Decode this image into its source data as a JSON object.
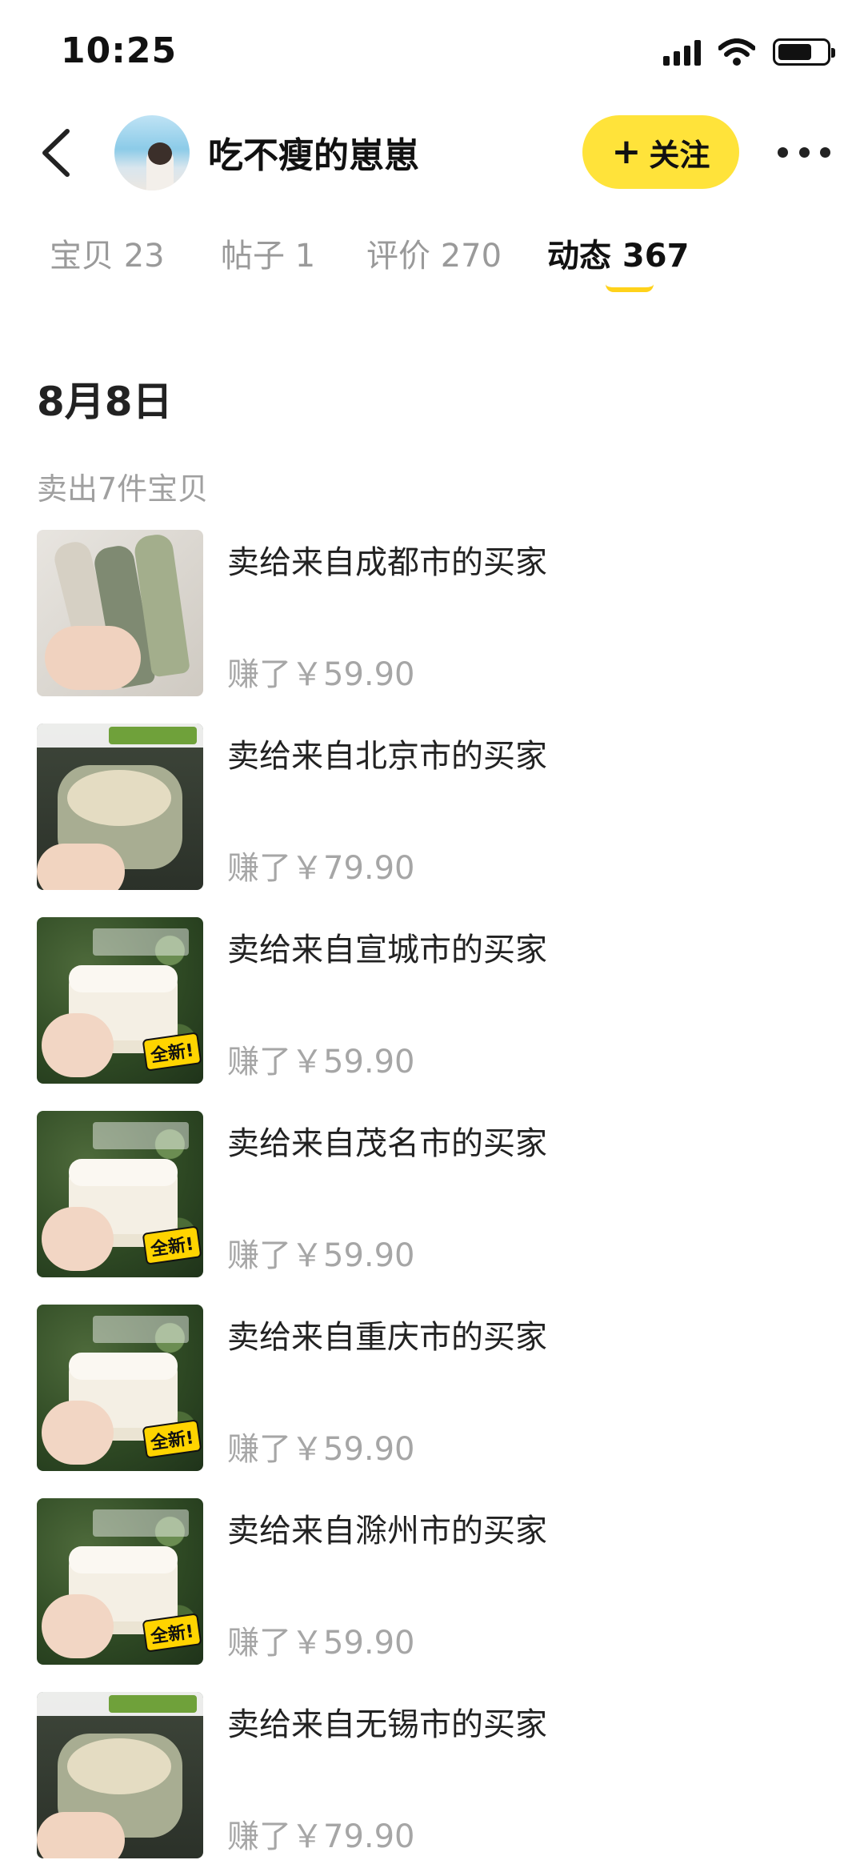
{
  "status_bar": {
    "time": "10:25"
  },
  "header": {
    "username": "吃不瘦的崽崽",
    "follow_label": "关注",
    "follow_plus": "+"
  },
  "tabs": [
    {
      "label": "宝贝 23",
      "active": false
    },
    {
      "label": "帖子 1",
      "active": false
    },
    {
      "label": "评价 270",
      "active": false
    },
    {
      "label": "动态 367",
      "active": true
    }
  ],
  "feed": {
    "date": "8月8日",
    "summary": "卖出7件宝贝",
    "items": [
      {
        "title": "卖给来自成都市的买家",
        "earned": "赚了￥59.90",
        "image": "bottles-photo",
        "badge": ""
      },
      {
        "title": "卖给来自北京市的买家",
        "earned": "赚了￥79.90",
        "image": "mask-jar-photo",
        "badge": ""
      },
      {
        "title": "卖给来自宣城市的买家",
        "earned": "赚了￥59.90",
        "image": "white-jar-photo",
        "badge": "全新!"
      },
      {
        "title": "卖给来自茂名市的买家",
        "earned": "赚了￥59.90",
        "image": "white-jar-photo",
        "badge": "全新!"
      },
      {
        "title": "卖给来自重庆市的买家",
        "earned": "赚了￥59.90",
        "image": "white-jar-photo",
        "badge": "全新!"
      },
      {
        "title": "卖给来自滁州市的买家",
        "earned": "赚了￥59.90",
        "image": "white-jar-photo",
        "badge": "全新!"
      },
      {
        "title": "卖给来自无锡市的买家",
        "earned": "赚了￥79.90",
        "image": "mask-jar-photo",
        "badge": ""
      }
    ]
  },
  "colors": {
    "accent": "#ffe33a",
    "indicator": "#ffd21a",
    "muted_text": "#a0a0a0"
  },
  "icons": [
    "back-arrow-icon",
    "signal-icon",
    "wifi-icon",
    "battery-icon",
    "more-dots-icon"
  ]
}
